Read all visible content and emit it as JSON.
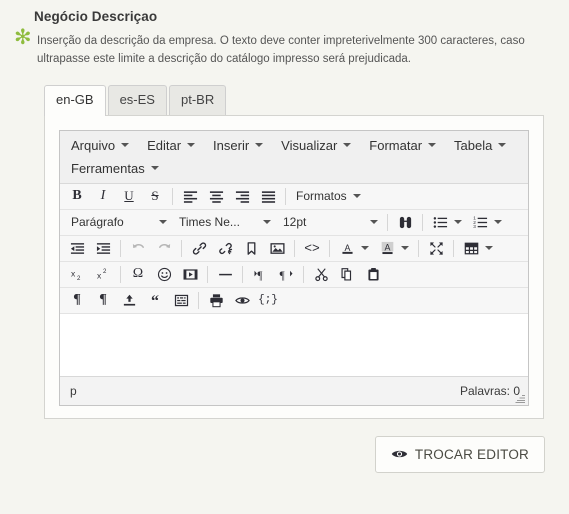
{
  "field": {
    "title": "Negócio Descriçao",
    "required_marker": "✻",
    "help_text": "Inserção da descrição da empresa. O texto deve conter impreterivelmente 300 caracteres, caso ultrapasse este limite a descrição do catálogo impresso será prejudicada.",
    "required_color": "#8fbc3f"
  },
  "tabs": [
    {
      "label": "en-GB",
      "active": true
    },
    {
      "label": "es-ES",
      "active": false
    },
    {
      "label": "pt-BR",
      "active": false
    }
  ],
  "editor": {
    "menubar": [
      {
        "label": "Arquivo",
        "icon": "chevron-down-icon"
      },
      {
        "label": "Editar",
        "icon": "chevron-down-icon"
      },
      {
        "label": "Inserir",
        "icon": "chevron-down-icon"
      },
      {
        "label": "Visualizar",
        "icon": "chevron-down-icon"
      },
      {
        "label": "Formatar",
        "icon": "chevron-down-icon"
      },
      {
        "label": "Tabela",
        "icon": "chevron-down-icon"
      },
      {
        "label": "Ferramentas",
        "icon": "chevron-down-icon"
      }
    ],
    "toolbar_row1": {
      "bold": "B",
      "italic": "I",
      "underline": "U",
      "strikethrough": "S",
      "align_left": "align-left-icon",
      "align_center": "align-center-icon",
      "align_right": "align-right-icon",
      "align_justify": "align-justify-icon",
      "formats_label": "Formatos"
    },
    "toolbar_row2": {
      "paragraph_value": "Parágrafo",
      "fontfamily_value": "Times Ne...",
      "fontsize_value": "12pt",
      "searchreplace": "search-replace-icon",
      "bullist": "bullet-list-icon",
      "numlist": "numbered-list-icon"
    },
    "toolbar_row3": {
      "outdent": "outdent-icon",
      "indent": "indent-icon",
      "undo": "undo-icon",
      "redo": "redo-icon",
      "link": "link-icon",
      "unlink": "unlink-icon",
      "anchor": "anchor-bookmark-icon",
      "image": "image-icon",
      "sourcecode": "source-code-icon",
      "forecolor": "text-color-icon",
      "backcolor": "background-color-icon",
      "fullscreen": "fullscreen-icon",
      "table": "table-icon"
    },
    "toolbar_row4": {
      "subscript": "subscript-icon",
      "superscript": "superscript-icon",
      "charmap": "special-character-icon",
      "emoticons": "emoticon-icon",
      "media": "media-icon",
      "hr": "horizontal-rule-icon",
      "ltr": "left-to-right-icon",
      "rtl": "right-to-left-icon",
      "cut": "cut-icon",
      "copy": "copy-icon",
      "paste": "paste-icon"
    },
    "toolbar_row5": {
      "pastetext": "paste-as-text-icon",
      "visualblocks": "visual-blocks-icon",
      "import": "import-icon",
      "blockquote": "blockquote-icon",
      "visualchars": "visual-characters-icon",
      "print": "print-icon",
      "preview": "preview-eye-icon",
      "template": "template-code-icon"
    },
    "content": "",
    "statusbar": {
      "path": "p",
      "wordcount": "Palavras: 0"
    }
  },
  "footer": {
    "trocar_editor_label": "TROCAR EDITOR",
    "trocar_editor_icon": "eye-icon"
  }
}
